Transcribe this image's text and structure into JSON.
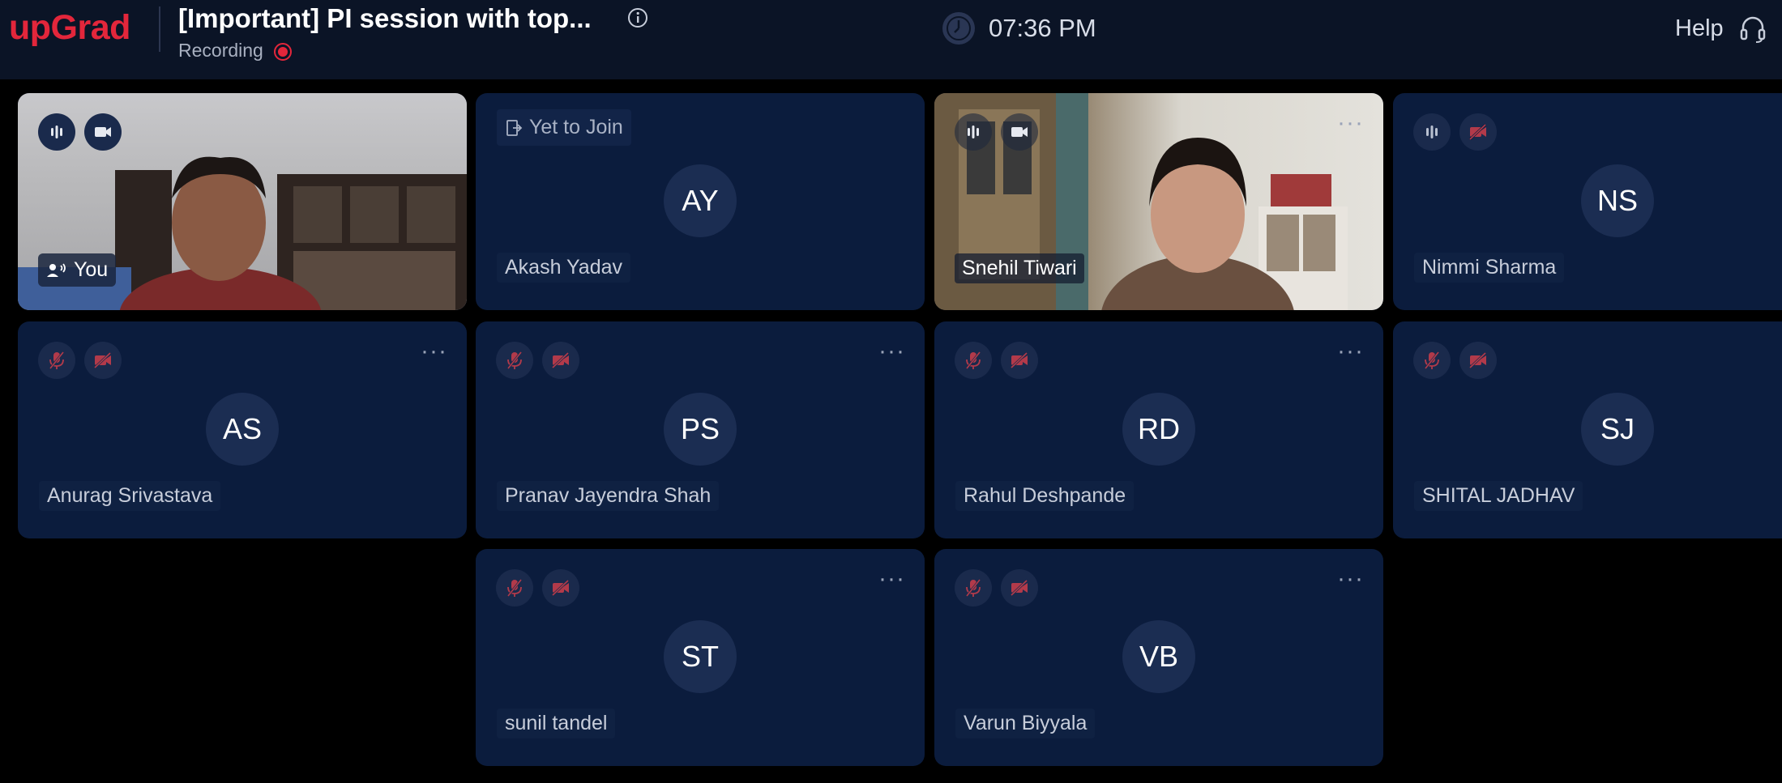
{
  "header": {
    "logo": "upGrad",
    "title": "[Important] PI session with top...",
    "recording_label": "Recording",
    "time": "07:36 PM",
    "help_label": "Help"
  },
  "colors": {
    "brand": "#e3263b",
    "header_bg": "#0b1426",
    "tile_bg": "#0b1c3d",
    "muted_icon": "#b23a4a"
  },
  "tiles": [
    {
      "name": "You",
      "state": "video",
      "mic": "on",
      "cam": "on"
    },
    {
      "initials": "AY",
      "name": "Akash Yadav",
      "status": "Yet to Join"
    },
    {
      "name": "Snehil Tiwari",
      "state": "video",
      "mic": "on",
      "cam": "on"
    },
    {
      "initials": "NS",
      "name": "Nimmi Sharma",
      "mic": "on",
      "cam": "off"
    },
    {
      "initials": "AS",
      "name": "Anurag Srivastava",
      "mic": "off",
      "cam": "off"
    },
    {
      "initials": "PS",
      "name": "Pranav Jayendra Shah",
      "mic": "off",
      "cam": "off"
    },
    {
      "initials": "RD",
      "name": "Rahul Deshpande",
      "mic": "off",
      "cam": "off"
    },
    {
      "initials": "SJ",
      "name": "SHITAL JADHAV",
      "mic": "off",
      "cam": "off"
    },
    {
      "initials": "ST",
      "name": "sunil tandel",
      "mic": "off",
      "cam": "off"
    },
    {
      "initials": "VB",
      "name": "Varun Biyyala",
      "mic": "off",
      "cam": "off"
    }
  ],
  "more_glyph": "···"
}
